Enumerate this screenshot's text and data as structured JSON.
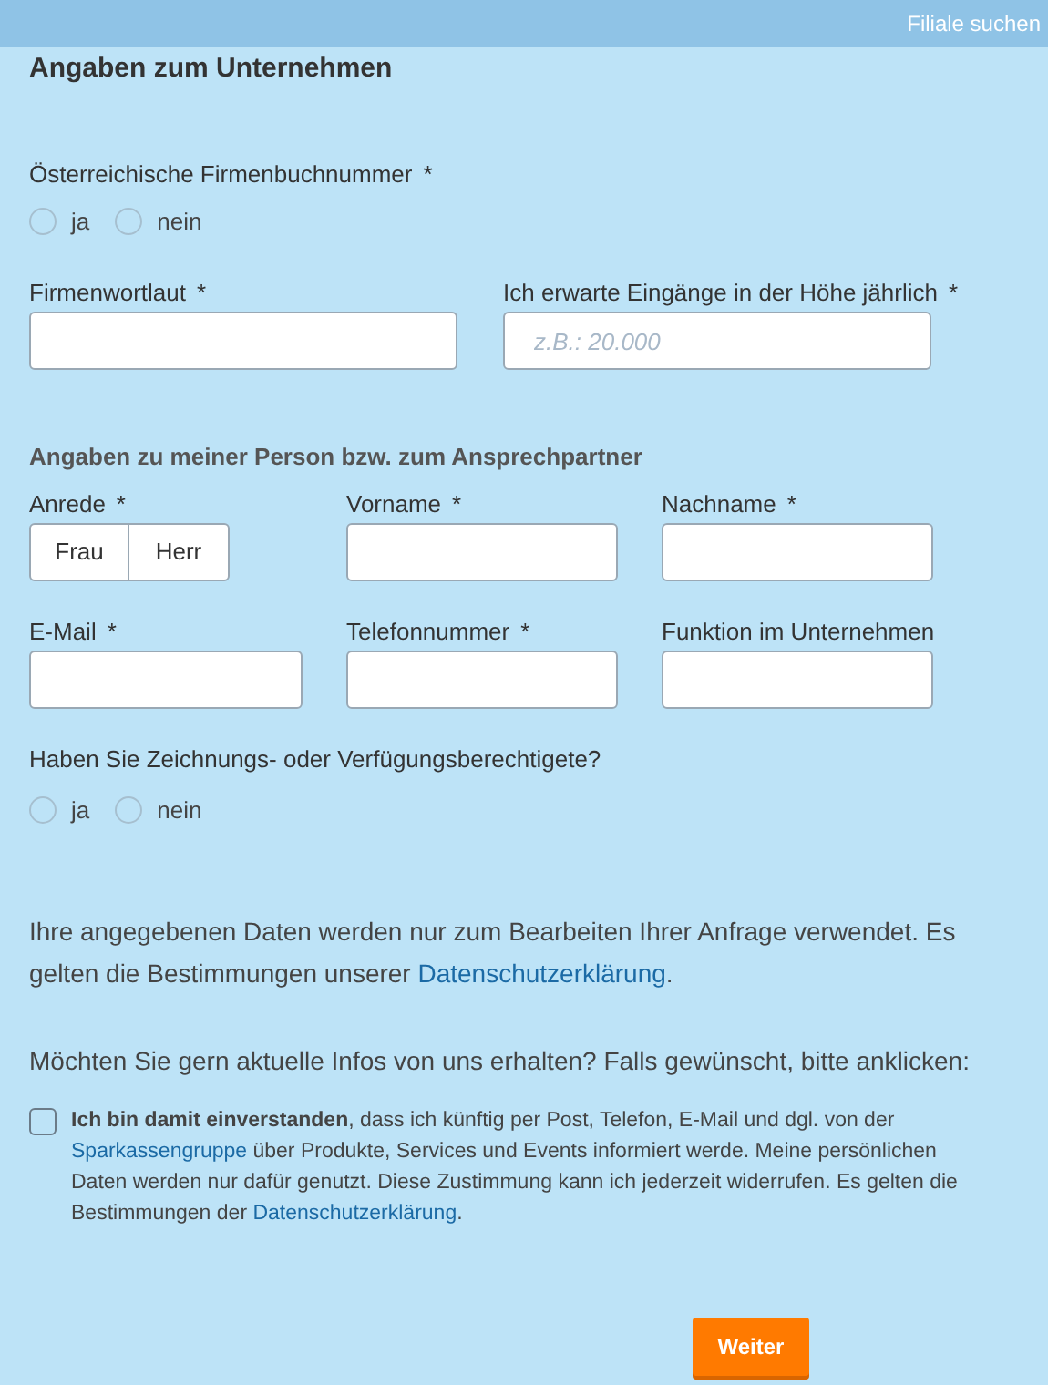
{
  "top_bar": {
    "link": "Filiale suchen"
  },
  "company": {
    "title": "Angaben zum Unternehmen",
    "register_question": {
      "label": "Österreichische Firmenbuchnummer",
      "mark": "*",
      "options": [
        {
          "label": "ja",
          "selected": false
        },
        {
          "label": "nein",
          "selected": false
        }
      ]
    },
    "fields": [
      {
        "label": "Firmenwortlaut",
        "mark": "*"
      },
      {
        "label": "Ich erwarte Eingänge in der Höhe jährlich",
        "mark": "*",
        "placeholder": "z.B.: 20.000"
      }
    ]
  },
  "person": {
    "title": "Angaben zu meiner Person bzw. zum Ansprechpartner",
    "salutation": {
      "label": "Anrede",
      "mark": "*",
      "options": [
        {
          "label": "Frau",
          "selected": false
        },
        {
          "label": "Herr",
          "selected": false
        }
      ]
    },
    "fields": [
      {
        "label": "Vorname",
        "mark": "*"
      },
      {
        "label": "Nachname",
        "mark": "*"
      },
      {
        "label": "E-Mail",
        "mark": "*"
      },
      {
        "label": "Telefonnummer",
        "mark": "*"
      },
      {
        "label": "Funktion im Unternehmen"
      }
    ],
    "signatory_question": {
      "label": "Haben Sie Zeichnungs- oder Verfügungsberechtigete?",
      "options": [
        {
          "label": "ja",
          "selected": false
        },
        {
          "label": "nein",
          "selected": false
        }
      ]
    }
  },
  "privacy_note": {
    "text": "Ihre angegebenen Daten werden nur zum Bearbeiten Ihrer Anfrage verwendet. Es gelten die Bestimmungen unserer",
    "link": "Datenschutzerklärung",
    "after": "."
  },
  "newsletter": {
    "question": "Möchten Sie gern aktuelle Infos von uns erhalten? Falls gewünscht, bitte anklicken:",
    "checked": false,
    "consent": [
      {
        "kind": "bold",
        "text": "Ich bin damit einverstanden"
      },
      {
        "kind": "text",
        "text": ", dass ich künftig per Post, Telefon, E-Mail und dgl. von der "
      },
      {
        "kind": "link",
        "text": "Sparkassengruppe"
      },
      {
        "kind": "text",
        "text": " über Produkte, Services und Events informiert werde. Meine persönlichen Daten werden nur dafür genutzt. Diese Zustimmung kann ich jederzeit widerrufen. Es gelten die Bestimmungen der "
      },
      {
        "kind": "link",
        "text": "Datenschutzerklärung"
      },
      {
        "kind": "text",
        "text": "."
      }
    ]
  },
  "submit": {
    "label": "Weiter"
  }
}
